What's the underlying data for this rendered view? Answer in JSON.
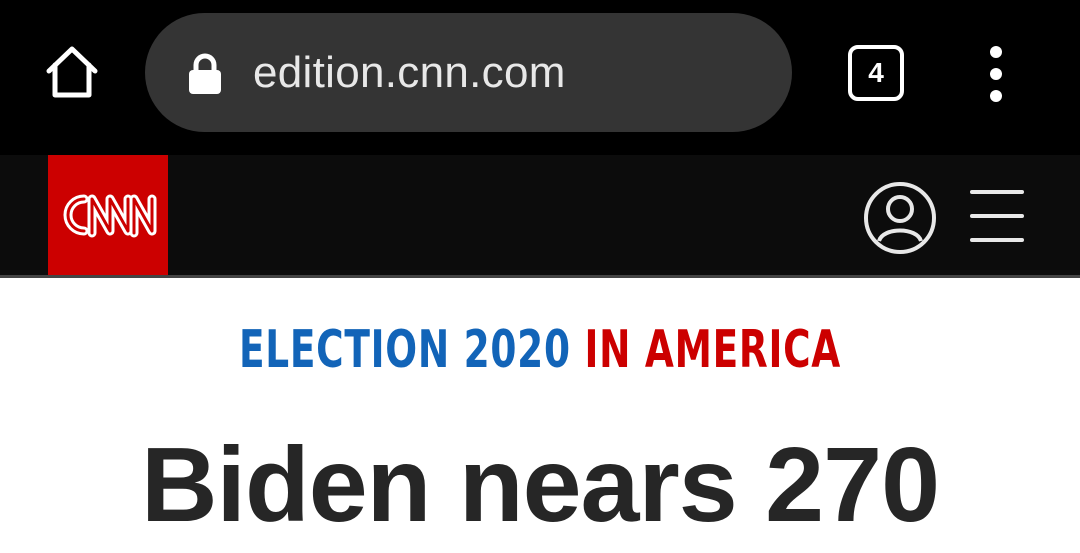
{
  "browser": {
    "url": "edition.cnn.com",
    "tab_count": "4",
    "icons": [
      "home-icon",
      "lock-icon",
      "tabs-icon",
      "more-vert-icon"
    ]
  },
  "site_header": {
    "logo_text": "CNN",
    "brand_color": "#cc0000",
    "icons": [
      "account-icon",
      "hamburger-menu-icon"
    ]
  },
  "article": {
    "kicker_part1": "ELECTION 2020",
    "kicker_part2": "IN AMERICA",
    "kicker_colors": [
      "#1264b8",
      "#cc0000"
    ],
    "headline": "Biden nears 270"
  }
}
